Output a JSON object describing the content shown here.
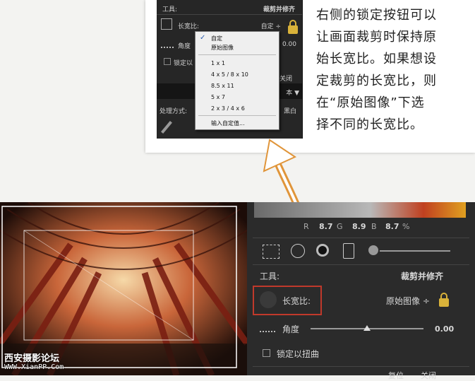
{
  "top_inset": {
    "tool_label": "工具:",
    "tool_name": "裁剪并修齐",
    "aspect_label": "长宽比:",
    "aspect_value": "自定 ÷",
    "angle_label": "角度",
    "angle_value": "0.00",
    "lock_label": "锁定以",
    "close_label": "关闭",
    "ben_label": "本 ▼",
    "process_label": "处理方式:",
    "bw_label": "黑白"
  },
  "dropdown": {
    "options": [
      "自定",
      "原始图像",
      "1 x 1",
      "4 x 5 / 8 x 10",
      "8.5 x 11",
      "5 x 7",
      "2 x 3 / 4 x 6",
      "输入自定值..."
    ],
    "checked": "✓"
  },
  "callout": {
    "text_lines": [
      "右侧的锁定按钮可以",
      "让画面裁剪时保持原",
      "始长宽比。如果想设",
      "定裁剪的长宽比，则",
      "在“原始图像”下选",
      "择不同的长宽比。"
    ]
  },
  "panel": {
    "readout": {
      "r_label": "R",
      "r_value": "8.7",
      "g_label": "G",
      "g_value": "8.9",
      "b_label": "B",
      "b_value": "8.7",
      "percent": "%"
    },
    "tool_label": "工具:",
    "tool_name": "裁剪并修齐",
    "aspect_label": "长宽比:",
    "aspect_value": "原始图像 ÷",
    "angle_label": "角度",
    "angle_value": "0.00",
    "angle_fraction": 0.5,
    "lock_warp_label": "锁定以扭曲",
    "reset_label": "复位",
    "close_label": "关闭"
  },
  "watermark": {
    "title": "西安摄影论坛",
    "url": "WWW.XianPP.Com"
  },
  "colors": {
    "highlight_box": "#c0392b",
    "arrow": "#e0953a",
    "lock": "#d9b23a"
  }
}
